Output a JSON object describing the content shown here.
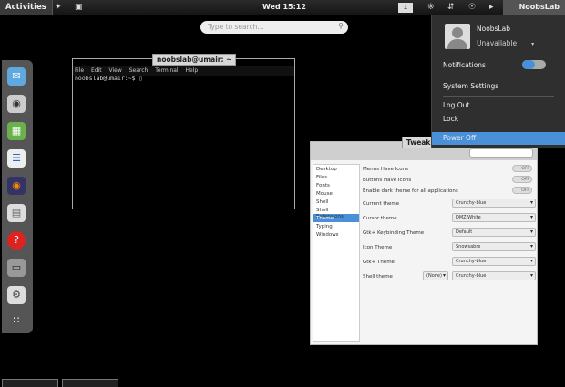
{
  "topbar": {
    "activities": "Activities",
    "clock": "Wed 15:12",
    "workspace": "1",
    "user": "NoobsLab",
    "icons": [
      "app-launcher-icon",
      "folder-icon",
      "bluetooth-icon",
      "network-icon",
      "accessibility-icon",
      "volume-icon"
    ]
  },
  "search": {
    "placeholder": "Type to search..."
  },
  "dash": {
    "icons": [
      "chat-icon",
      "speaker-icon",
      "photos-icon",
      "document-icon",
      "firefox-icon",
      "disk-icon",
      "help-icon",
      "terminal-icon",
      "settings-icon",
      "show-apps-icon"
    ]
  },
  "terminal": {
    "title": "noobslab@umair: ~",
    "menu": [
      "File",
      "Edit",
      "View",
      "Search",
      "Terminal",
      "Help"
    ],
    "prompt": "noobslab@umair:~$ "
  },
  "tweak": {
    "title": "Tweak Tool",
    "sidebar": [
      "Desktop",
      "Files",
      "Fonts",
      "Mouse",
      "Shell",
      "Shell Extensions",
      "Theme",
      "Typing",
      "Windows"
    ],
    "selected": "Theme",
    "switch_rows": [
      {
        "label": "Menus Have Icons",
        "value": "OFF"
      },
      {
        "label": "Buttons Have Icons",
        "value": "OFF"
      },
      {
        "label": "Enable dark theme for all applications",
        "value": "OFF"
      }
    ],
    "combo_rows": [
      {
        "label": "Current theme",
        "value": "Crunchy-blue"
      },
      {
        "label": "Cursor theme",
        "value": "DMZ-White"
      },
      {
        "label": "Gtk+ Keybinding Theme",
        "value": "Default"
      },
      {
        "label": "Icon Theme",
        "value": "Snowsabre"
      },
      {
        "label": "Gtk+ Theme",
        "value": "Crunchy-blue"
      },
      {
        "label": "Shell theme",
        "value": "Crunchy-blue",
        "extra": "(None)"
      }
    ]
  },
  "usermenu": {
    "name": "NoobsLab",
    "status": "Unavailable",
    "notifications": "Notifications",
    "system_settings": "System Settings",
    "log_out": "Log Out",
    "lock": "Lock",
    "power_off": "Power Off"
  },
  "colors": {
    "accent": "#4a90d9",
    "panel": "#1e1e1e"
  }
}
